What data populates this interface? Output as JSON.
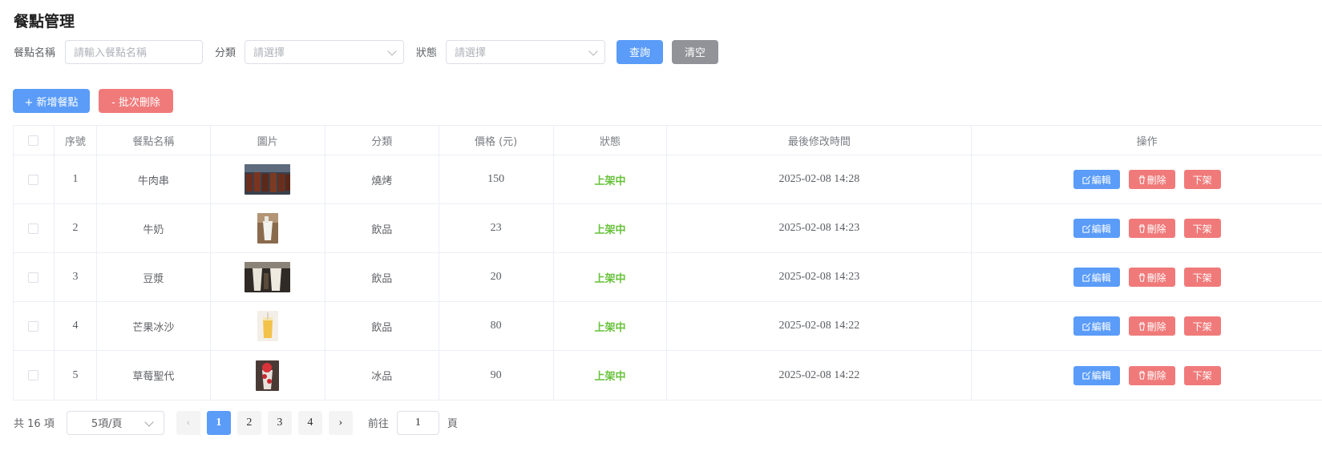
{
  "page": {
    "title": "餐點管理"
  },
  "filters": {
    "name_label": "餐點名稱",
    "name_placeholder": "請輸入餐點名稱",
    "category_label": "分類",
    "category_placeholder": "請選擇",
    "status_label": "狀態",
    "status_placeholder": "請選擇",
    "search_label": "查詢",
    "clear_label": "清空"
  },
  "actions": {
    "add_label": "+ 新增餐點",
    "batch_delete_label": "- 批次刪除"
  },
  "table": {
    "headers": [
      "",
      "序號",
      "餐點名稱",
      "圖片",
      "分類",
      "價格 (元)",
      "狀態",
      "最後修改時間",
      "操作"
    ],
    "rows": [
      {
        "no": "1",
        "name": "牛肉串",
        "image": "beef-skewer-photo",
        "category": "燒烤",
        "price": "150",
        "status": "上架中",
        "updated": "2025-02-08 14:28"
      },
      {
        "no": "2",
        "name": "牛奶",
        "image": "milk-photo",
        "category": "飲品",
        "price": "23",
        "status": "上架中",
        "updated": "2025-02-08 14:23"
      },
      {
        "no": "3",
        "name": "豆漿",
        "image": "soy-milk-photo",
        "category": "飲品",
        "price": "20",
        "status": "上架中",
        "updated": "2025-02-08 14:23"
      },
      {
        "no": "4",
        "name": "芒果冰沙",
        "image": "mango-smoothie-photo",
        "category": "飲品",
        "price": "80",
        "status": "上架中",
        "updated": "2025-02-08 14:22"
      },
      {
        "no": "5",
        "name": "草莓聖代",
        "image": "strawberry-sundae-photo",
        "category": "冰品",
        "price": "90",
        "status": "上架中",
        "updated": "2025-02-08 14:22"
      }
    ],
    "row_actions": {
      "edit": "編輯",
      "delete": "刪除",
      "offline": "下架"
    }
  },
  "pagination": {
    "total_text": "共 16 項",
    "page_size": "5項/頁",
    "pages": [
      "1",
      "2",
      "3",
      "4"
    ],
    "current_page": "1",
    "prev_icon": "‹",
    "next_icon": "›",
    "goto_label": "前往",
    "goto_value": "1",
    "goto_suffix": "頁"
  },
  "colors": {
    "primary": "#5a9cf8",
    "danger": "#f07a7a",
    "success": "#67c23a",
    "neutral": "#919398"
  }
}
